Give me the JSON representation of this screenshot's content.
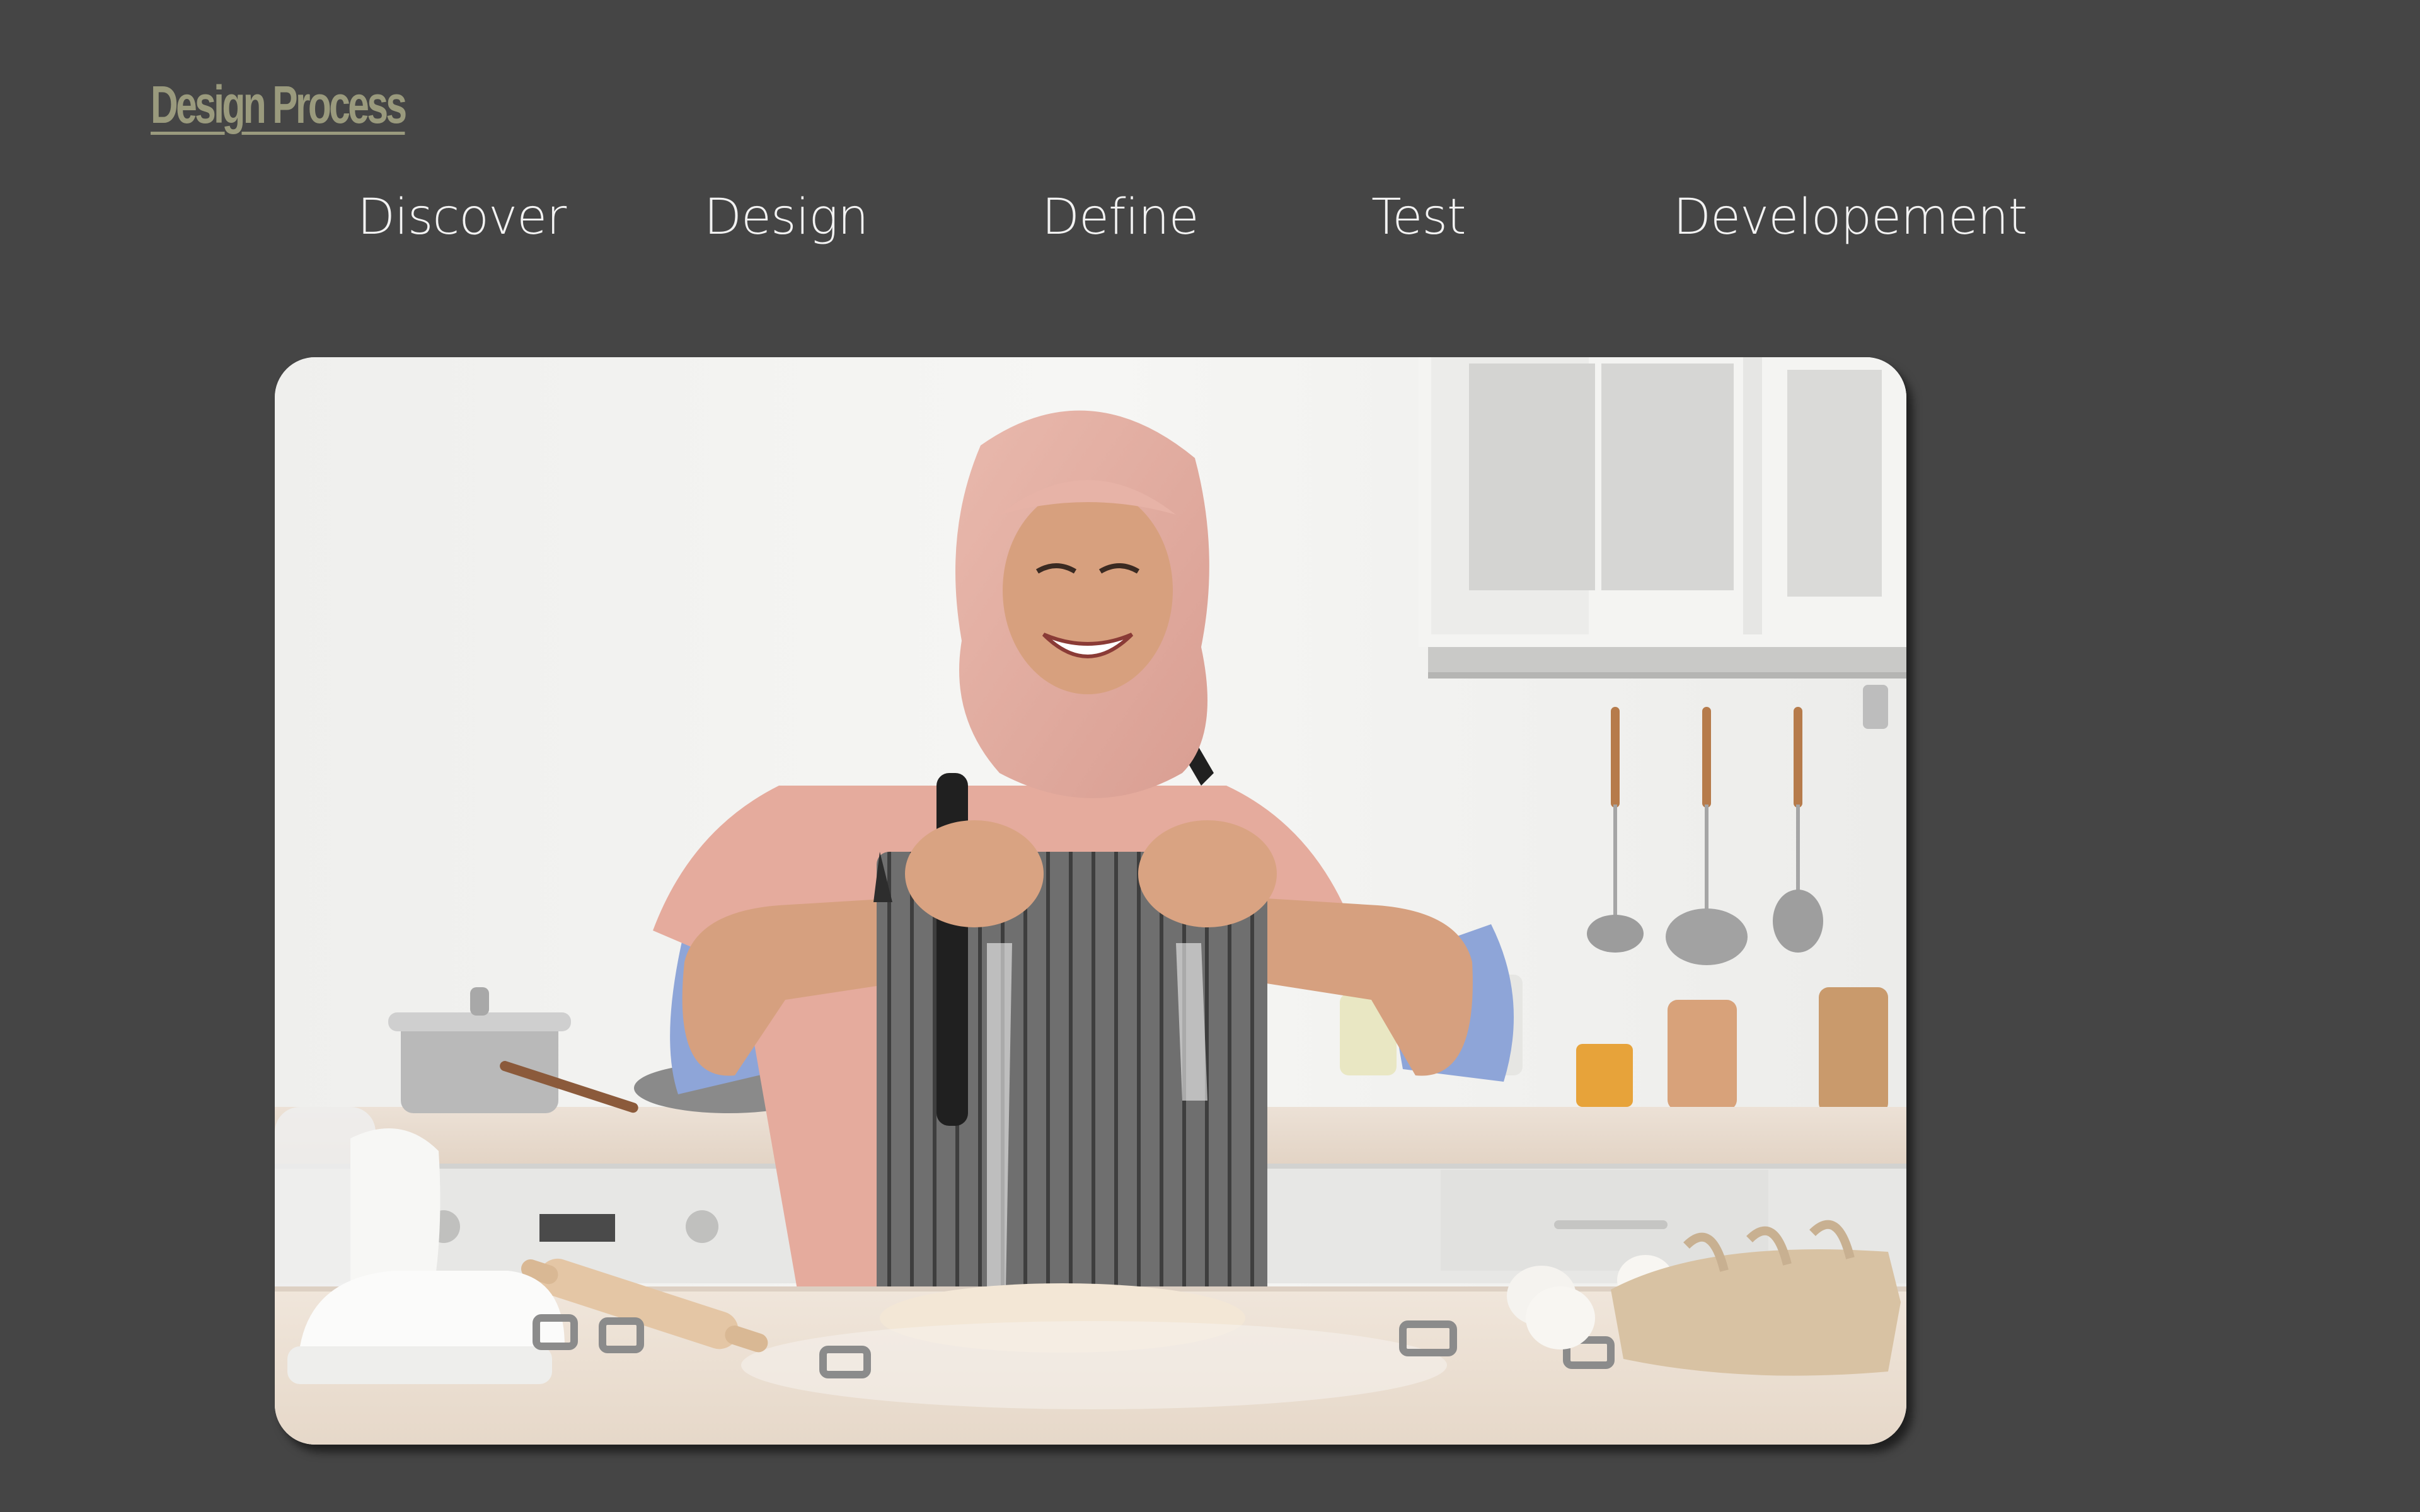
{
  "header": {
    "brand_title": "Design Process"
  },
  "nav": {
    "items": [
      {
        "label": "Discover"
      },
      {
        "label": "Design"
      },
      {
        "label": "Define"
      },
      {
        "label": "Test"
      },
      {
        "label": "Developement"
      }
    ]
  },
  "colors": {
    "background": "#454545",
    "brand": "#9a9a7d",
    "nav_text": "#f2f2f2"
  }
}
